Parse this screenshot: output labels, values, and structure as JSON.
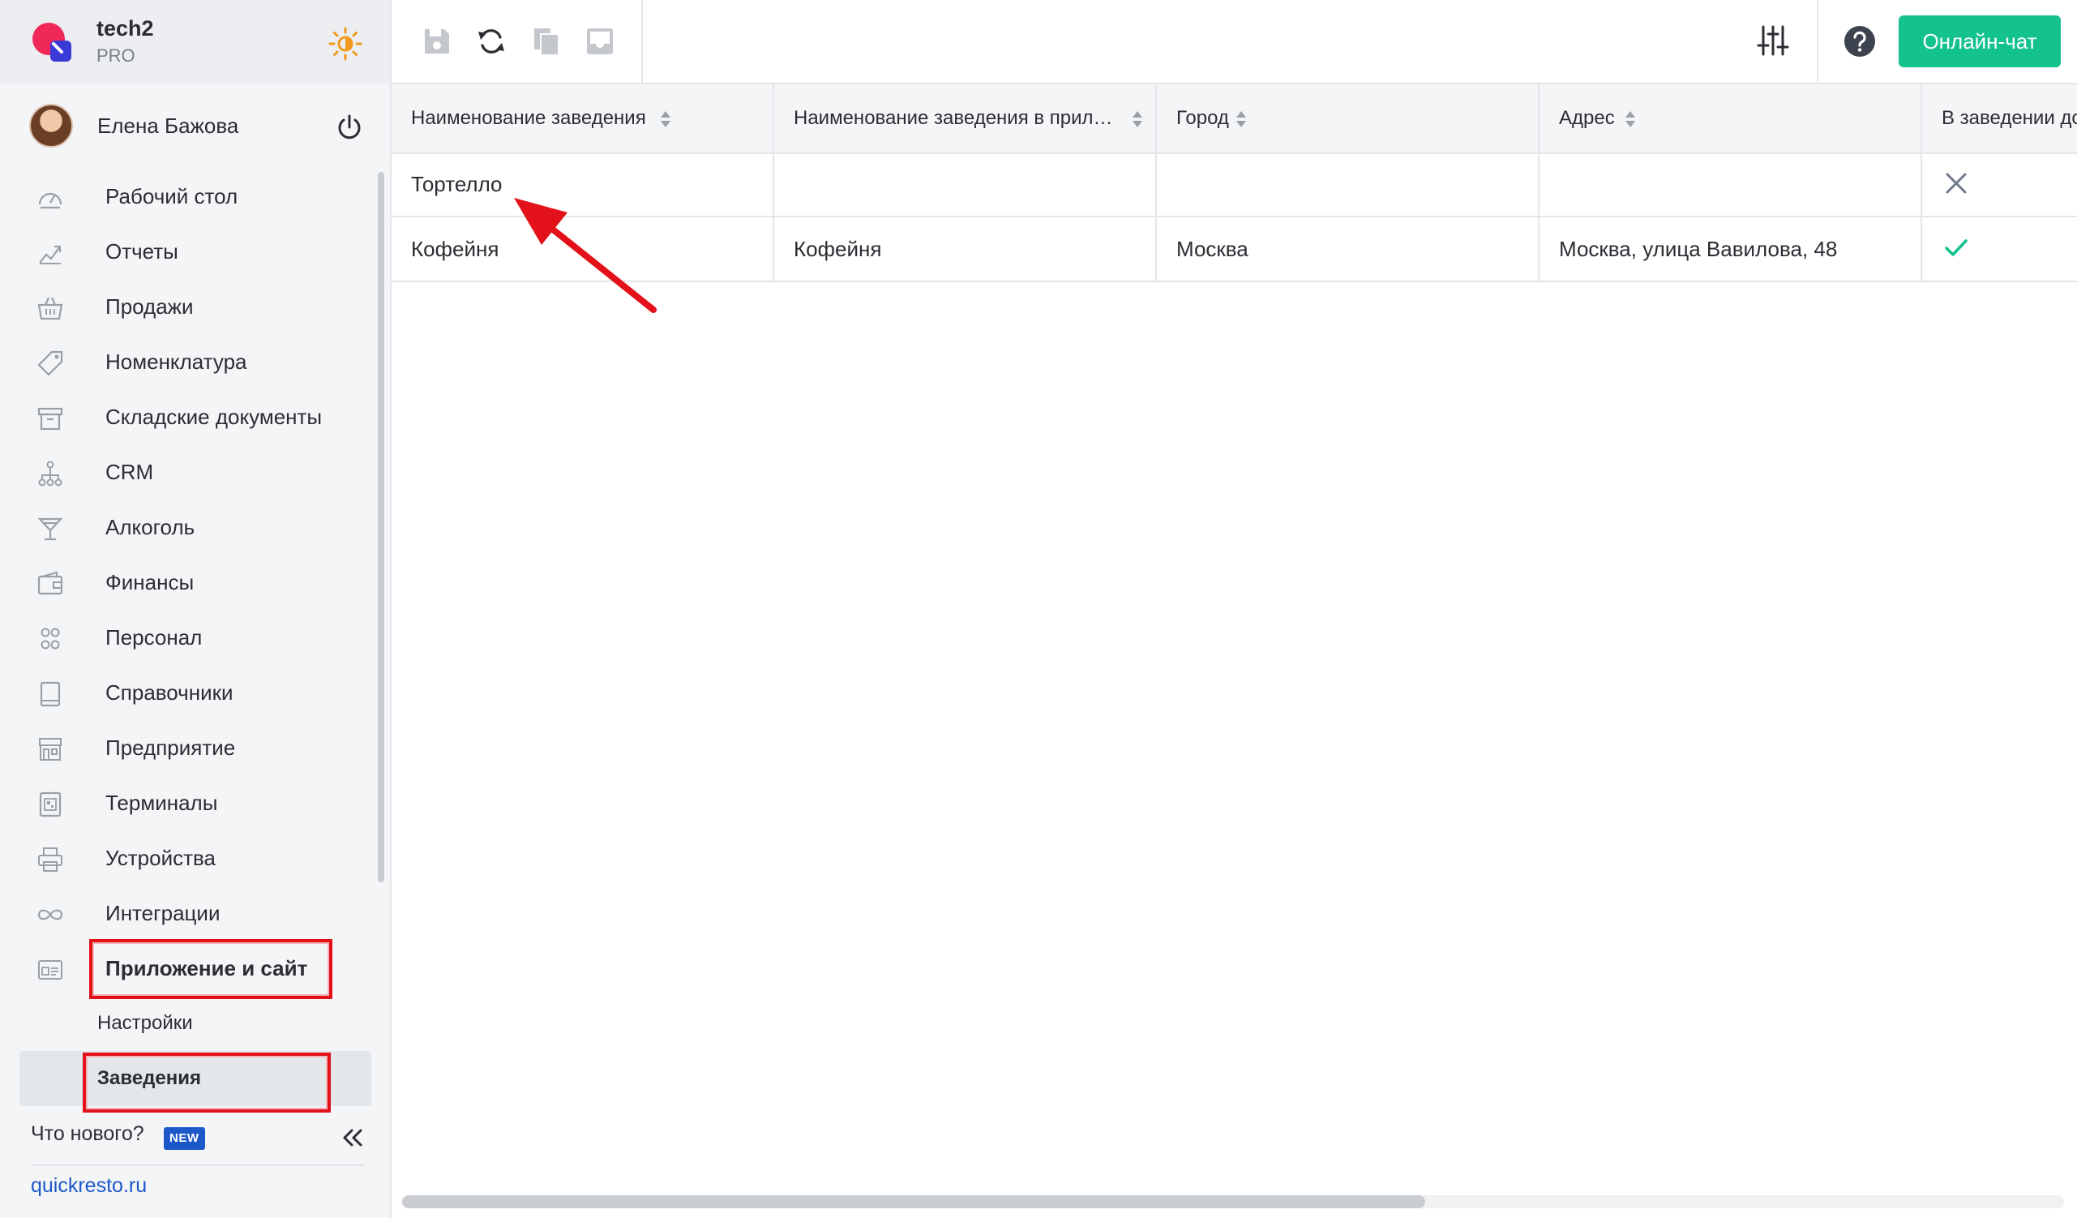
{
  "brand": {
    "name": "tech2",
    "plan": "PRO"
  },
  "user": {
    "name": "Елена Бажова"
  },
  "menu": [
    {
      "label": "Рабочий стол",
      "icon": "dashboard-icon"
    },
    {
      "label": "Отчеты",
      "icon": "chart-line-icon"
    },
    {
      "label": "Продажи",
      "icon": "basket-icon"
    },
    {
      "label": "Номенклатура",
      "icon": "tag-icon"
    },
    {
      "label": "Складские документы",
      "icon": "archive-box-icon"
    },
    {
      "label": "CRM",
      "icon": "hierarchy-icon"
    },
    {
      "label": "Алкоголь",
      "icon": "cocktail-glass-icon"
    },
    {
      "label": "Финансы",
      "icon": "wallet-icon"
    },
    {
      "label": "Персонал",
      "icon": "people-icon"
    },
    {
      "label": "Справочники",
      "icon": "book-icon"
    },
    {
      "label": "Предприятие",
      "icon": "storefront-icon"
    },
    {
      "label": "Терминалы",
      "icon": "qr-terminal-icon"
    },
    {
      "label": "Устройства",
      "icon": "printer-icon"
    },
    {
      "label": "Интеграции",
      "icon": "infinity-icon"
    },
    {
      "label": "Приложение и сайт",
      "icon": "app-window-icon"
    }
  ],
  "submenu": [
    {
      "label": "Настройки"
    },
    {
      "label": "Заведения"
    }
  ],
  "footer": {
    "whats_new": "Что нового?",
    "new_badge": "NEW",
    "site_link": "quickresto.ru"
  },
  "toolbar": {
    "chat_label": "Онлайн-чат"
  },
  "table": {
    "columns": [
      {
        "label": "Наименование заведения"
      },
      {
        "label": "Наименование заведения в прил…"
      },
      {
        "label": "Город"
      },
      {
        "label": "Адрес"
      },
      {
        "label": "В заведении до"
      }
    ],
    "rows": [
      {
        "name": "Тортелло",
        "app_name": "",
        "city": "",
        "address": "",
        "status": "cross"
      },
      {
        "name": "Кофейня",
        "app_name": "Кофейня",
        "city": "Москва",
        "address": "Москва, улица Вавилова, 48",
        "status": "check"
      }
    ]
  },
  "colors": {
    "accent_green": "#14c28d",
    "annotation_red": "#e3111a",
    "link_blue": "#1d58c9"
  }
}
